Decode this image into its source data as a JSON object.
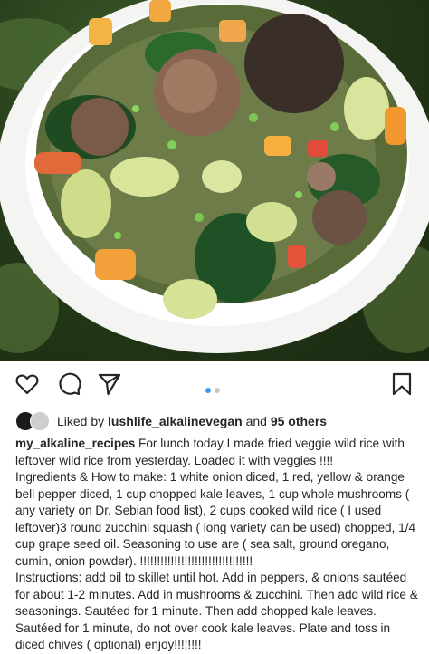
{
  "post": {
    "image_alt_icon": "food-photo",
    "carousel": {
      "count": 2,
      "active_index": 0,
      "active_color": "#3897f0",
      "inactive_color": "#c7c7c7"
    }
  },
  "actions": {
    "like_icon": "heart-icon",
    "comment_icon": "comment-icon",
    "share_icon": "send-icon",
    "save_icon": "bookmark-icon"
  },
  "likes": {
    "prefix": "Liked by",
    "user": "lushlife_alkalinevegan",
    "connector": "and",
    "others": "95 others"
  },
  "caption": {
    "username": "my_alkaline_recipes",
    "intro": " For lunch today I made fried veggie wild rice with leftover wild rice from yesterday. Loaded it with veggies !!!!",
    "ingredients": "Ingredients & How to make: 1 white onion diced, 1 red, yellow & orange bell pepper diced, 1 cup chopped kale leaves, 1 cup whole mushrooms ( any variety on Dr. Sebian food list), 2 cups cooked wild rice ( I used leftover)3 round zucchini squash ( long variety can be used) chopped, 1/4 cup grape seed oil. Seasoning to use are ( sea salt, ground oregano, cumin, onion powder). !!!!!!!!!!!!!!!!!!!!!!!!!!!!!!!!!",
    "instructions": "Instructions: add oil to skillet until hot. Add in peppers, & onions sautéed for about 1-2 minutes. Add in mushrooms & zucchini. Then add wild rice & seasonings. Sautéed for 1 minute. Then add chopped kale leaves. Sautéed for 1 minute, do not over cook kale leaves. Plate and toss in diced chives ( optional) enjoy!!!!!!!!"
  }
}
